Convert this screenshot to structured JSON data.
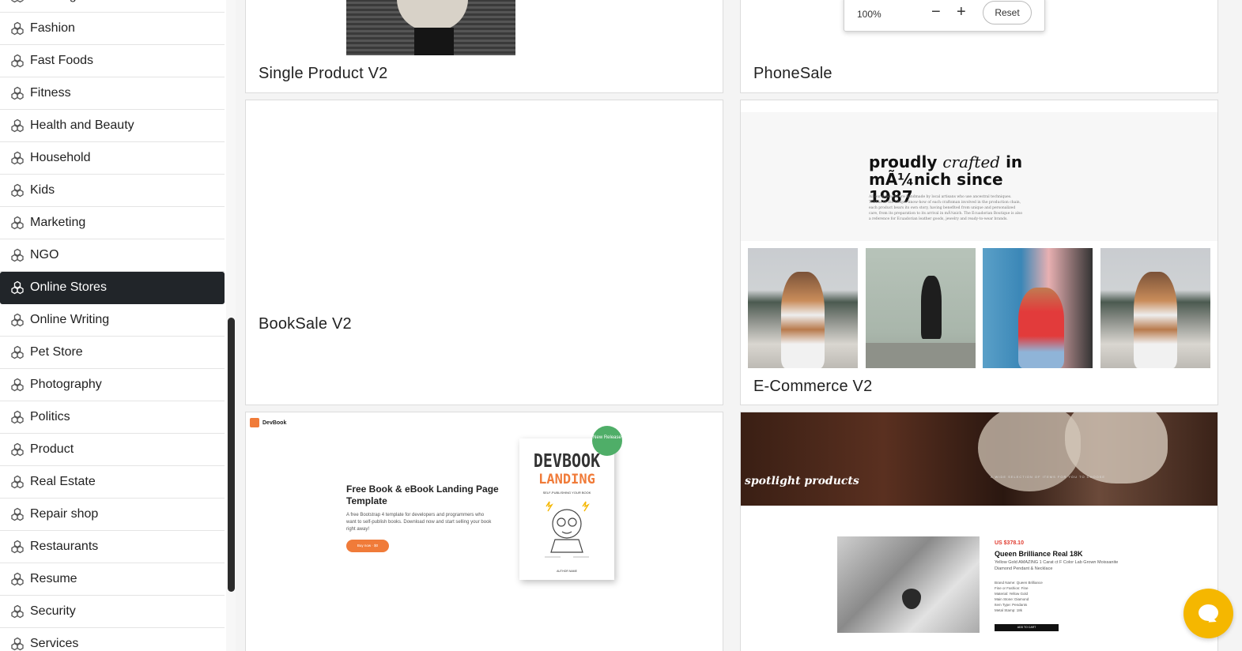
{
  "sidebar": {
    "items": [
      {
        "label": "Farming",
        "active": false
      },
      {
        "label": "Fashion",
        "active": false
      },
      {
        "label": "Fast Foods",
        "active": false
      },
      {
        "label": "Fitness",
        "active": false
      },
      {
        "label": "Health and Beauty",
        "active": false
      },
      {
        "label": "Household",
        "active": false
      },
      {
        "label": "Kids",
        "active": false
      },
      {
        "label": "Marketing",
        "active": false
      },
      {
        "label": "NGO",
        "active": false
      },
      {
        "label": "Online Stores",
        "active": true
      },
      {
        "label": "Online Writing",
        "active": false
      },
      {
        "label": "Pet Store",
        "active": false
      },
      {
        "label": "Photography",
        "active": false
      },
      {
        "label": "Politics",
        "active": false
      },
      {
        "label": "Product",
        "active": false
      },
      {
        "label": "Real Estate",
        "active": false
      },
      {
        "label": "Repair shop",
        "active": false
      },
      {
        "label": "Restaurants",
        "active": false
      },
      {
        "label": "Resume",
        "active": false
      },
      {
        "label": "Security",
        "active": false
      },
      {
        "label": "Services",
        "active": false
      }
    ],
    "item_icon": "cubes-icon"
  },
  "zoom": {
    "value": "100%",
    "minus": "−",
    "plus": "+",
    "reset": "Reset"
  },
  "templates": {
    "single_product": {
      "title": "Single Product V2"
    },
    "phonesale": {
      "title": "PhoneSale"
    },
    "booksale": {
      "title": "BookSale V2"
    },
    "ecommerce": {
      "title": "E-Commerce V2",
      "headline_a": "proudly",
      "headline_b": "crafted",
      "headline_c": "in",
      "headline_d": "mÃ¼nich since 1987",
      "paragraph": "All our products are handmade by local artisans who use ancestral techniques. Thanks to the unique know-how of each craftsman involved in the production chain, each product bears its own story, having benefited from unique and personalized care, from its preparation to its arrival in mÃ¼nich. The Ecuadorian Boutique is also a reference for Ecuadorian leather goods, jewelry and ready-to-wear brands."
    },
    "devbook": {
      "logo": "DevBook",
      "title": "Free Book & eBook Landing Page Template",
      "text": "A free Bootstrap 4 template for developers and programmers who want to self-publish books. Download now and start selling your book right away!",
      "button": "Buy now · $0",
      "book_line1": "DEVBOOK",
      "book_line2": "LANDING",
      "book_line3": "SELF-PUBLISHING YOUR BOOK",
      "book_author": "AUTHOR NAME",
      "badge": "New Release"
    },
    "spotlight": {
      "banner_title": "spotlight products",
      "banner_sub": "A WIDE SELECTION OF ITEMS FOR YOU TO CHOOSE",
      "price": "US $378.10",
      "name": "Queen Brilliance Real 18K",
      "desc": "Yellow Gold AMAZING 1 Carat ct F Color Lab Grown Moissanite Diamond Pendant & Necklace",
      "specs": [
        "Brand Name: Queen Brilliance",
        "Fine or Fashion: Fine",
        "Material: Yellow Gold",
        "Main Stone: Diamond",
        "Item Type: Pendants",
        "Metal Stamp: 18k"
      ],
      "cart": "ADD TO CART"
    }
  },
  "colors": {
    "accent_dark": "#212529",
    "chat": "#f5b700",
    "devbook_orange": "#f07b39",
    "badge_green": "#4fae68"
  }
}
